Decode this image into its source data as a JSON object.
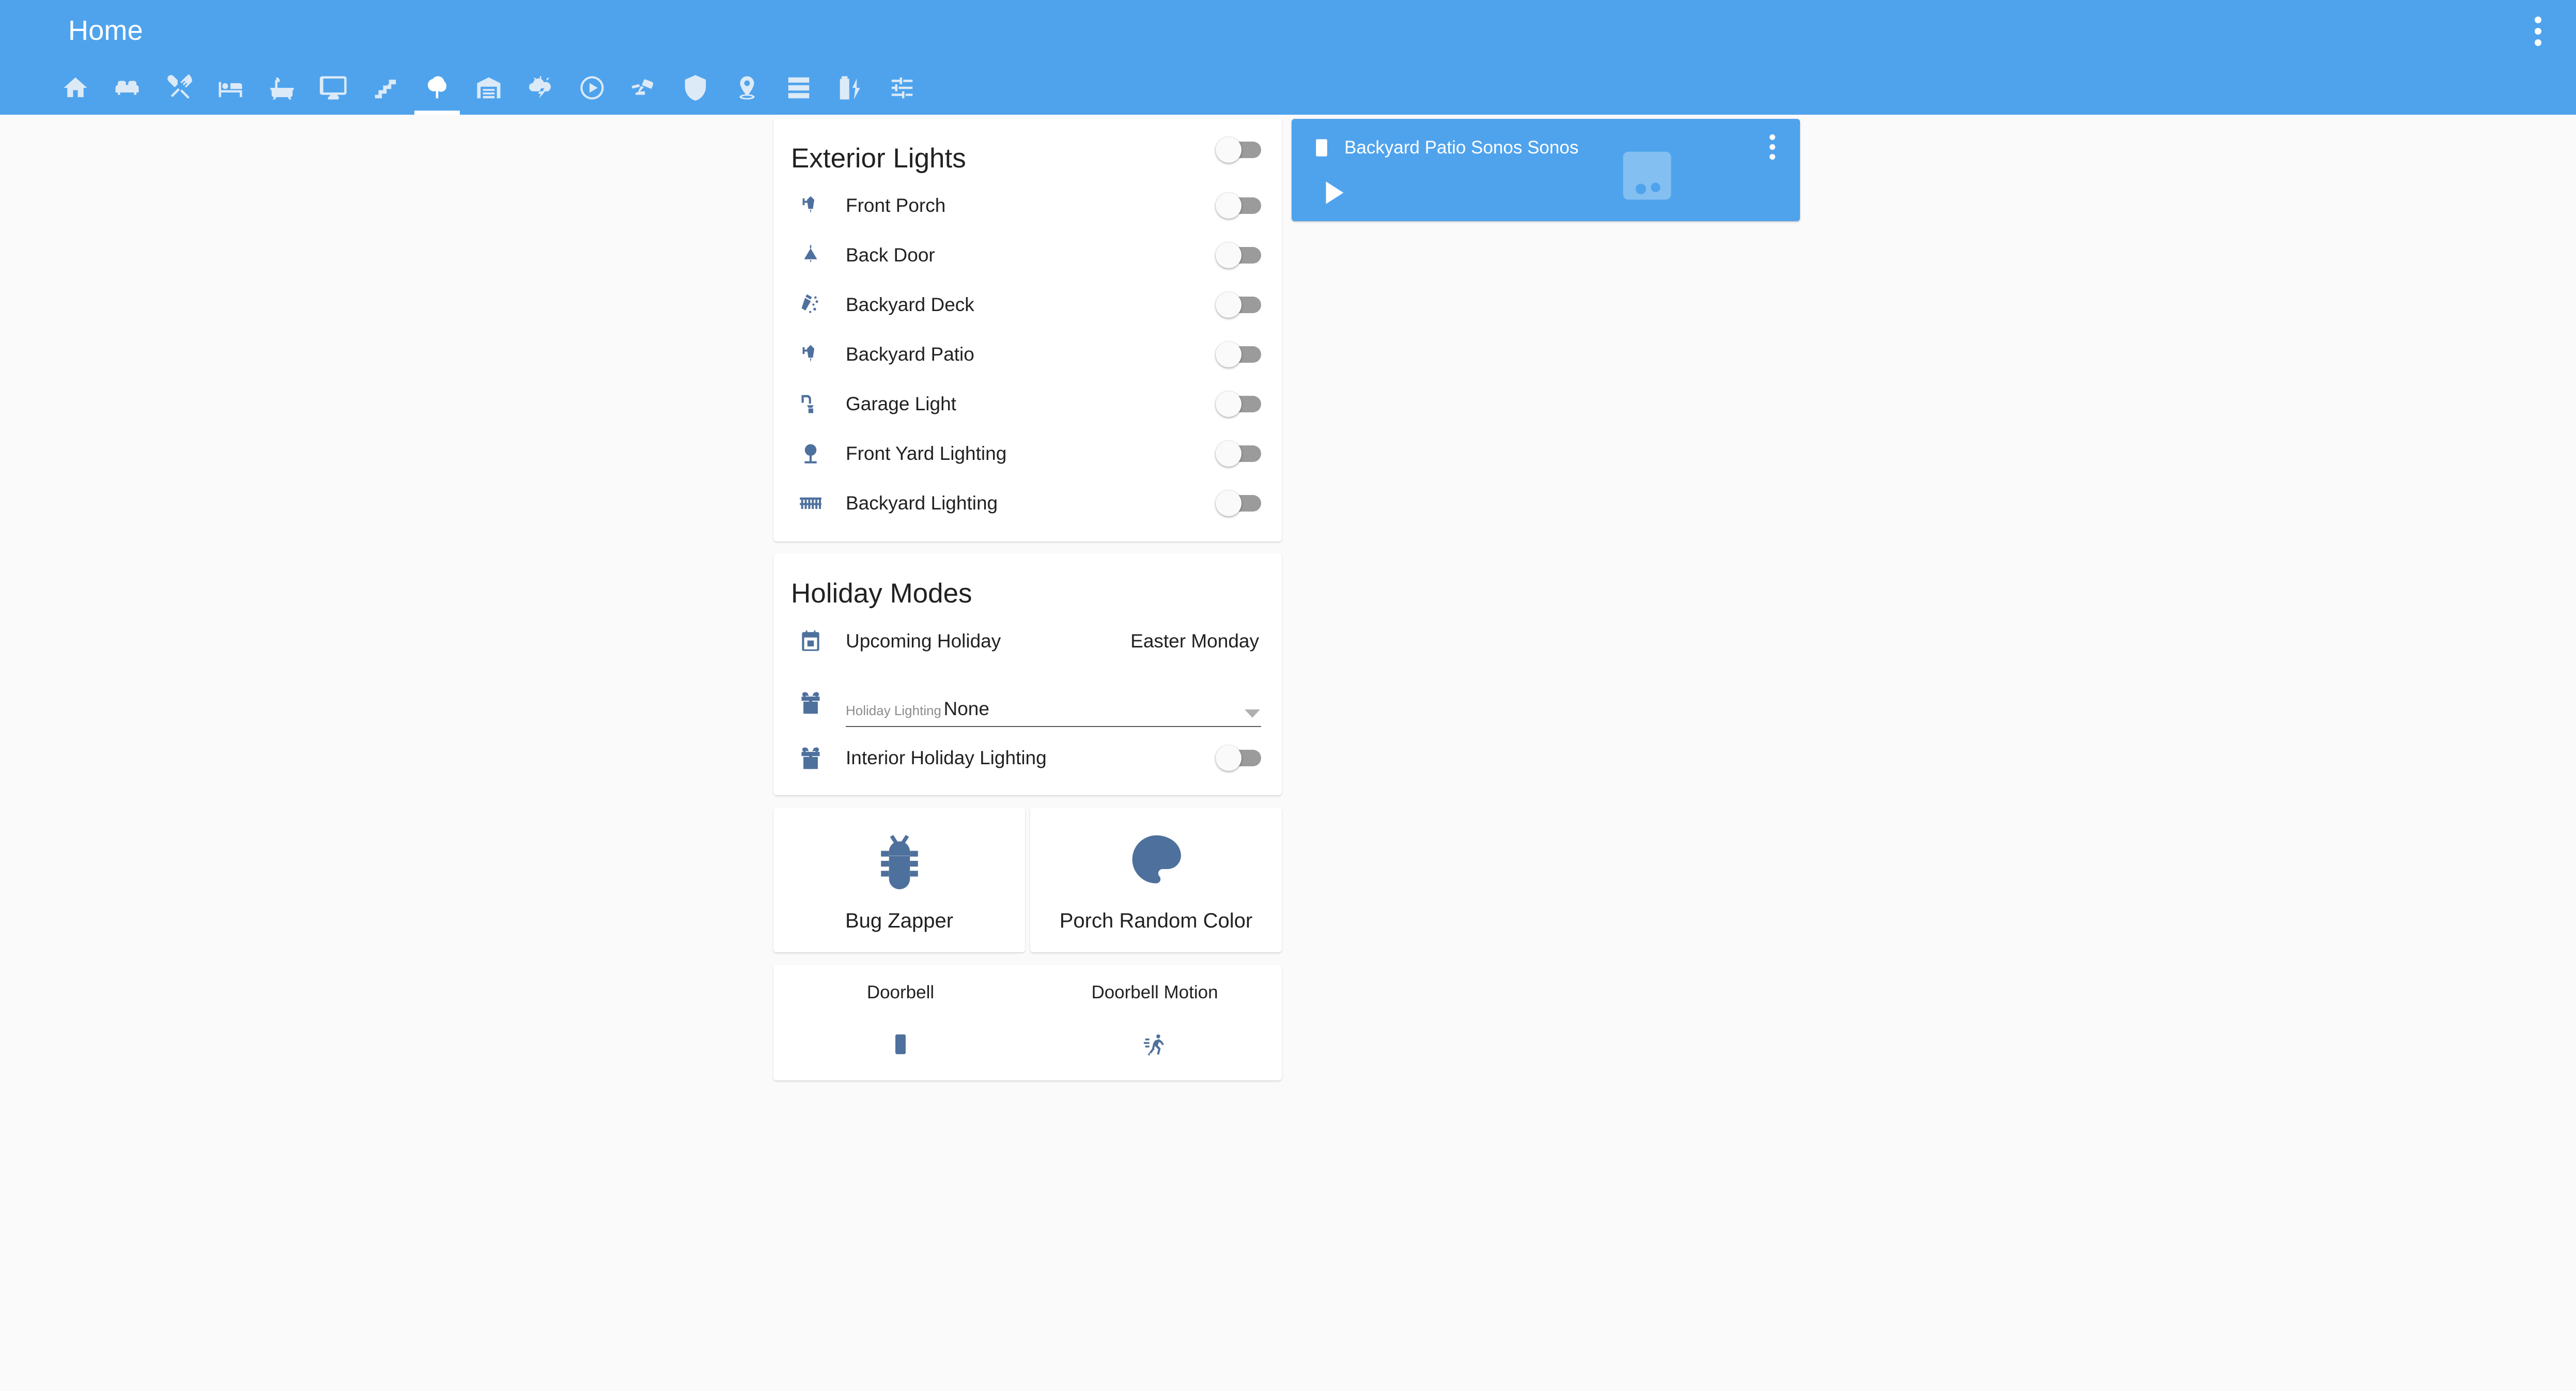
{
  "app": {
    "title": "Home",
    "accent_color": "#4fa3ec",
    "background_color": "#fafafa",
    "icon_color": "#4e709c",
    "overflow_icon": "dots-vertical-icon"
  },
  "tabs": [
    {
      "icon": "home-icon",
      "name": "home",
      "active": false
    },
    {
      "icon": "sofa-icon",
      "name": "living-room",
      "active": false
    },
    {
      "icon": "silverware-fork-knife-icon",
      "name": "kitchen",
      "active": false
    },
    {
      "icon": "bed-icon",
      "name": "bedroom",
      "active": false
    },
    {
      "icon": "bathtub-icon",
      "name": "bathroom",
      "active": false
    },
    {
      "icon": "monitor-icon",
      "name": "office",
      "active": false
    },
    {
      "icon": "stairs-icon",
      "name": "stairs",
      "active": false
    },
    {
      "icon": "tree-icon",
      "name": "outside",
      "active": true
    },
    {
      "icon": "garage-icon",
      "name": "garage",
      "active": false
    },
    {
      "icon": "weather-lightning-icon",
      "name": "weather",
      "active": false
    },
    {
      "icon": "play-circle-outline-icon",
      "name": "media",
      "active": false
    },
    {
      "icon": "cctv-icon",
      "name": "cameras",
      "active": false
    },
    {
      "icon": "shield-home-icon",
      "name": "security",
      "active": false
    },
    {
      "icon": "map-marker-icon",
      "name": "location",
      "active": false
    },
    {
      "icon": "server-icon",
      "name": "system",
      "active": false
    },
    {
      "icon": "battery-charging-icon",
      "name": "battery",
      "active": false
    },
    {
      "icon": "tune-icon",
      "name": "settings",
      "active": false
    }
  ],
  "exterior_lights": {
    "title": "Exterior Lights",
    "master_toggle": {
      "state": "off",
      "name": "exterior-lights-master-toggle"
    },
    "rows": [
      {
        "label": "Front Porch",
        "icon": "outdoor-lamp-icon",
        "state": "off"
      },
      {
        "label": "Back Door",
        "icon": "ceiling-light-icon",
        "state": "off"
      },
      {
        "label": "Backyard Deck",
        "icon": "spotlight-beam-icon",
        "state": "off"
      },
      {
        "label": "Backyard Patio",
        "icon": "outdoor-lamp-icon",
        "state": "off"
      },
      {
        "label": "Garage Light",
        "icon": "wall-sconce-icon",
        "state": "off"
      },
      {
        "label": "Front Yard Lighting",
        "icon": "tree-light-icon",
        "state": "off"
      },
      {
        "label": "Backyard Lighting",
        "icon": "string-lights-icon",
        "state": "off"
      }
    ]
  },
  "holiday_modes": {
    "title": "Holiday Modes",
    "upcoming": {
      "label": "Upcoming Holiday",
      "value": "Easter Monday",
      "icon": "calendar-icon"
    },
    "lighting_select": {
      "label": "Holiday Lighting",
      "value": "None",
      "icon": "gift-icon",
      "options": [
        "None"
      ]
    },
    "interior_toggle": {
      "label": "Interior Holiday Lighting",
      "icon": "gift-icon",
      "state": "off"
    }
  },
  "scene_buttons": [
    {
      "label": "Bug Zapper",
      "icon": "bug-icon"
    },
    {
      "label": "Porch Random Color",
      "icon": "palette-icon"
    }
  ],
  "sensors": [
    {
      "label": "Doorbell",
      "icon": "doorbell-icon"
    },
    {
      "label": "Doorbell Motion",
      "icon": "run-icon"
    }
  ],
  "media_player": {
    "title": "Backyard Patio Sonos Sonos",
    "source_icon": "speaker-icon",
    "watermark_icon": "music-box-icon",
    "play_icon": "play-icon",
    "overflow_icon": "dots-vertical-icon",
    "background_color": "#4fa3ec"
  }
}
